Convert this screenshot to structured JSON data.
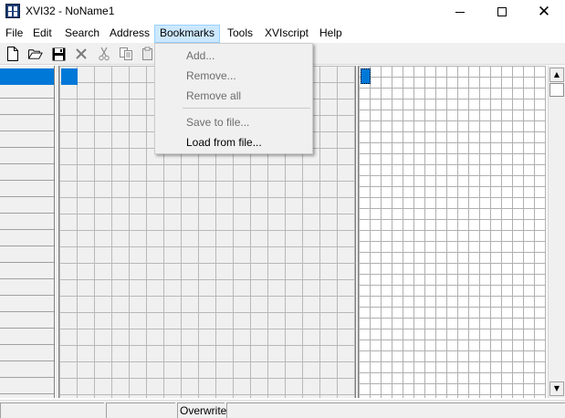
{
  "window": {
    "title": "XVI32 - NoName1"
  },
  "icons": {
    "app": "hex-editor-app-icon",
    "minimize": "minimize-icon",
    "maximize": "maximize-icon",
    "close": "close-icon"
  },
  "menubar": {
    "items": [
      {
        "label": "File"
      },
      {
        "label": "Edit"
      },
      {
        "label": "Search"
      },
      {
        "label": "Address"
      },
      {
        "label": "Bookmarks"
      },
      {
        "label": "Tools"
      },
      {
        "label": "XVIscript"
      },
      {
        "label": "Help"
      }
    ],
    "open_menu": "Bookmarks"
  },
  "bookmarks_menu": {
    "items": [
      {
        "label": "Add...",
        "enabled": false
      },
      {
        "label": "Remove...",
        "enabled": false
      },
      {
        "label": "Remove all",
        "enabled": false
      },
      {
        "label": "Save to file...",
        "enabled": false
      },
      {
        "label": "Load from file...",
        "enabled": true
      }
    ]
  },
  "toolbar": {
    "buttons": [
      "new-file-icon",
      "open-folder-icon",
      "save-icon",
      "delete-x-icon",
      "cut-scissors-icon",
      "copy-icon",
      "paste-icon"
    ]
  },
  "statusbar": {
    "panels": [
      {
        "text": ""
      },
      {
        "text": ""
      },
      {
        "text": "Overwrite"
      },
      {
        "text": ""
      }
    ]
  },
  "colors": {
    "selection": "#0078d7",
    "menu_highlight": "#cce8ff",
    "panel_bg": "#f0f0f0",
    "disabled_text": "#6d6d6d"
  }
}
